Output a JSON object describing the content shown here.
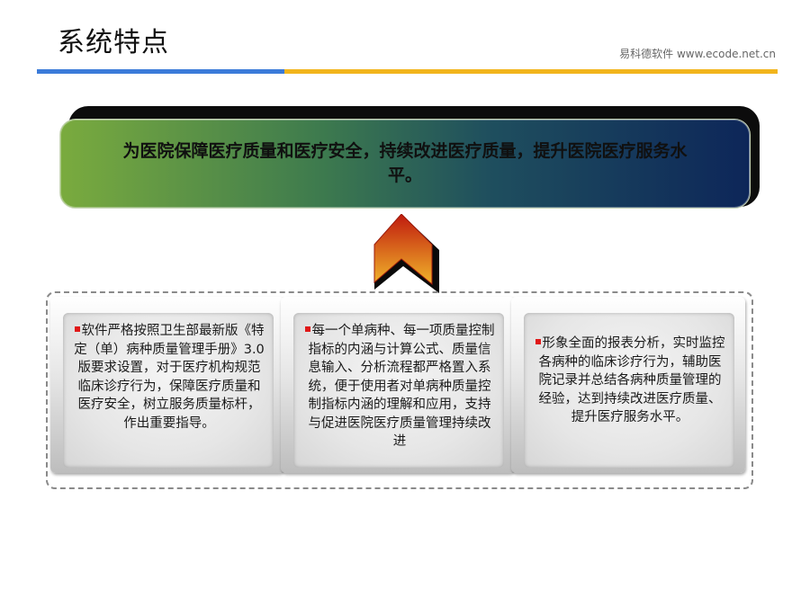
{
  "header": {
    "title": "系统特点",
    "brand": "易科德软件  www.ecode.net.cn"
  },
  "banner": {
    "text": "为医院保障医疗质量和医疗安全，持续改进医疗质量，提升医院医疗服务水平。"
  },
  "cards": [
    {
      "text": "软件严格按照卫生部最新版《特定（单）病种质量管理手册》3.0版要求设置，对于医疗机构规范临床诊疗行为，保障医疗质量和医疗安全，树立服务质量标杆，作出重要指导。"
    },
    {
      "text": "每一个单病种、每一项质量控制指标的内涵与计算公式、质量信息输入、分析流程都严格置入系统，便于使用者对单病种质量控制指标内涵的理解和应用，支持与促进医院医疗质量管理持续改进"
    },
    {
      "text": "形象全面的报表分析，实时监控各病种的临床诊疗行为，辅助医院记录并总结各病种质量管理的经验，达到持续改进医疗质量、提升医疗服务水平。"
    }
  ],
  "colors": {
    "rule_blue": "#3b7bd9",
    "rule_yellow": "#f2b51c",
    "bullet": "#e01818",
    "arrow_top": "#c01a0e",
    "arrow_bottom": "#f0b42a"
  }
}
